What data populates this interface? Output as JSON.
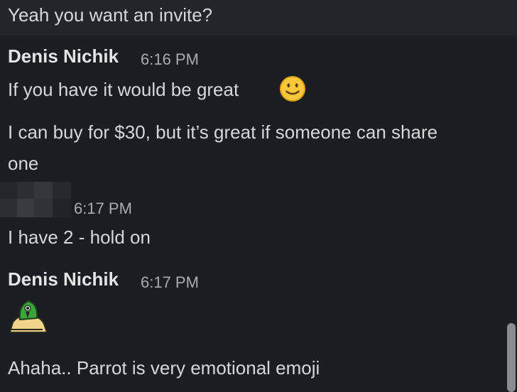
{
  "messages": {
    "top": "Yeah you want an invite?",
    "group1": {
      "sender": "Denis Nichik",
      "time": "6:16 PM",
      "line1": "If you have it would be great",
      "line2a": "I can buy for $30, but it’s great if someone can share",
      "line2b": "one"
    },
    "group2": {
      "time": "6:17 PM",
      "line1": "I have 2 - hold on"
    },
    "group3": {
      "sender": "Denis Nichik",
      "time": "6:17 PM",
      "line1": "Ahaha.. Parrot is very emotional emoji"
    }
  },
  "icons": {
    "smile": "slightly-smiling-face-icon",
    "parrot": "parrot-emoji-icon",
    "avatar": "blurred-avatar"
  },
  "colors": {
    "background": "#1a1d21",
    "top_background": "#222529",
    "text": "#d6d7d8",
    "time": "#ababad",
    "emoji_yellow": "#f6c83a"
  }
}
